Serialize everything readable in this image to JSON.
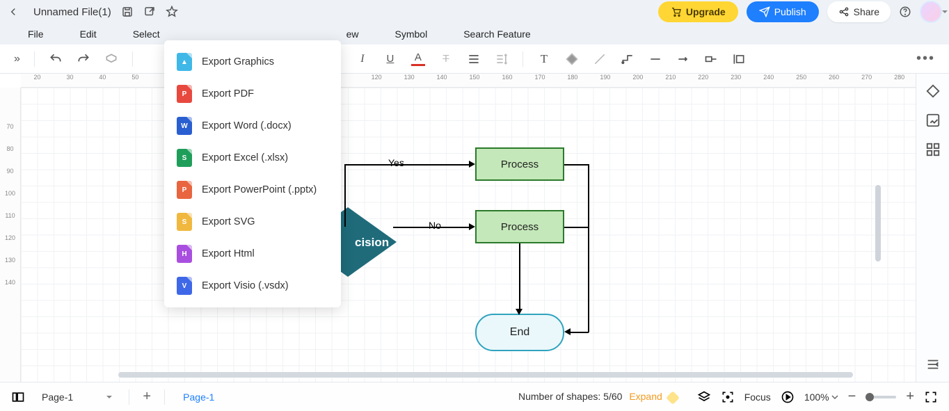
{
  "header": {
    "filename": "Unnamed File(1)",
    "upgrade": "Upgrade",
    "publish": "Publish",
    "share": "Share"
  },
  "menu": {
    "file": "File",
    "edit": "Edit",
    "select": "Select",
    "view_suffix": "ew",
    "symbol": "Symbol",
    "search": "Search Feature"
  },
  "export_menu": {
    "graphics": "Export Graphics",
    "pdf": "Export PDF",
    "word": "Export Word (.docx)",
    "excel": "Export Excel (.xlsx)",
    "ppt": "Export PowerPoint (.pptx)",
    "svg": "Export SVG",
    "html": "Export Html",
    "visio": "Export Visio (.vsdx)"
  },
  "ruler_h": [
    "20",
    "30",
    "40",
    "50",
    "120",
    "130",
    "140",
    "150",
    "160",
    "170",
    "180",
    "190",
    "200",
    "210",
    "220",
    "230",
    "240",
    "250",
    "260",
    "270",
    "280"
  ],
  "ruler_v": [
    "70",
    "80",
    "90",
    "100",
    "110",
    "120",
    "130",
    "140"
  ],
  "flow": {
    "decision": "cision",
    "process1": "Process",
    "process2": "Process",
    "end": "End",
    "yes": "Yes",
    "no": "No"
  },
  "bottom": {
    "page_select": "Page-1",
    "page_tab": "Page-1",
    "shapes_label": "Number of shapes: ",
    "shapes_count": "5/60",
    "expand": "Expand",
    "focus": "Focus",
    "zoom": "100%"
  }
}
